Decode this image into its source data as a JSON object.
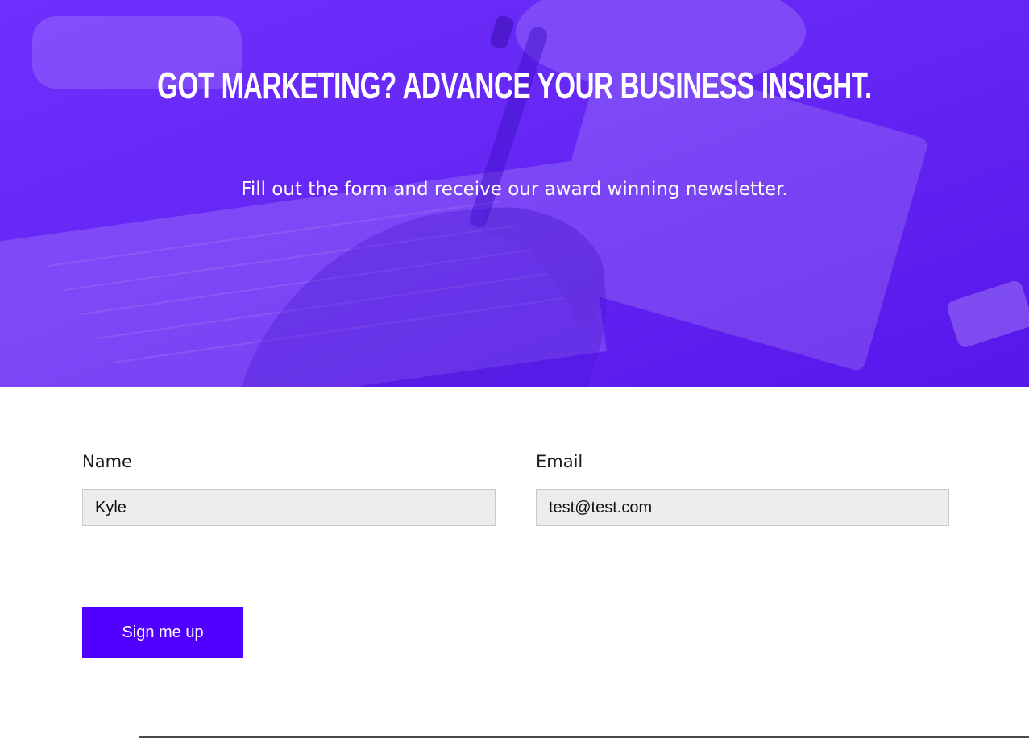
{
  "hero": {
    "title": "Got Marketing? Advance your business insight.",
    "subtitle": "Fill out the form and receive our award winning newsletter.",
    "overlay_color": "#6e2dff"
  },
  "form": {
    "name": {
      "label": "Name",
      "value": "Kyle"
    },
    "email": {
      "label": "Email",
      "value": "test@test.com"
    },
    "submit_label": "Sign me up",
    "button_color": "#5100ff"
  }
}
